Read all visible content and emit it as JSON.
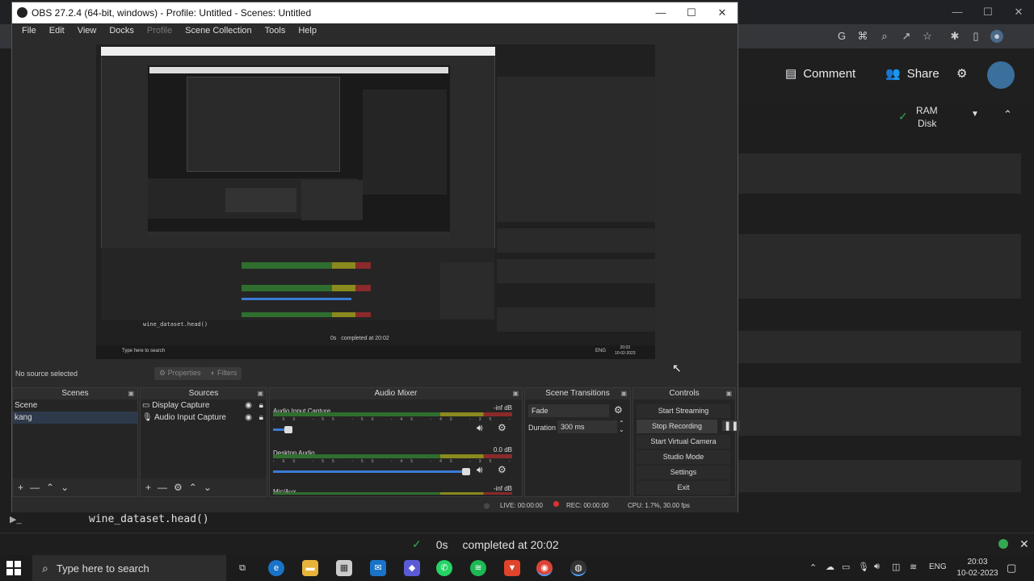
{
  "background": {
    "header": {
      "comment": "Comment",
      "share": "Share"
    },
    "ram": "RAM",
    "disk": "Disk",
    "code": "wine_dataset.head()",
    "status": {
      "time": "0s",
      "completed": "completed at 20:02"
    }
  },
  "obs": {
    "title": "OBS 27.2.4 (64-bit, windows) - Profile: Untitled - Scenes: Untitled",
    "menu": [
      "File",
      "Edit",
      "View",
      "Docks",
      "Profile",
      "Scene Collection",
      "Tools",
      "Help"
    ],
    "preview": {
      "code": "wine_dataset.head()",
      "status": "completed at 20:02",
      "status_time": "0s",
      "search": "Type here to search",
      "clock_time": "20:03",
      "clock_date": "10-02-2023",
      "lang": "ENG"
    },
    "source_bar": {
      "no_source": "No source selected",
      "properties": "Properties",
      "filters": "Filters"
    },
    "docks": {
      "scenes": {
        "title": "Scenes",
        "items": [
          "Scene",
          "kang"
        ]
      },
      "sources": {
        "title": "Sources",
        "items": [
          "Display Capture",
          "Audio Input Capture"
        ]
      },
      "mixer": {
        "title": "Audio Mixer",
        "channels": [
          {
            "name": "Audio Input Capture",
            "db": "-inf dB"
          },
          {
            "name": "Desktop Audio",
            "db": "0.0 dB"
          },
          {
            "name": "Mic/Aux",
            "db": "-inf dB"
          }
        ],
        "scale": "-60 -55 -50 -45 -40 -35 -30 -25 -20 -15 -10 -5 0"
      },
      "transitions": {
        "title": "Scene Transitions",
        "selected": "Fade",
        "duration_label": "Duration",
        "duration_value": "300 ms"
      },
      "controls": {
        "title": "Controls",
        "buttons": [
          "Start Streaming",
          "Stop Recording",
          "Start Virtual Camera",
          "Studio Mode",
          "Settings",
          "Exit"
        ]
      }
    },
    "statusbar": {
      "live": "LIVE: 00:00:00",
      "rec": "REC: 00:00:00",
      "cpu": "CPU: 1.7%, 30.00 fps"
    }
  },
  "taskbar": {
    "search": "Type here to search",
    "lang": "ENG",
    "time": "20:03",
    "date": "10-02-2023"
  }
}
